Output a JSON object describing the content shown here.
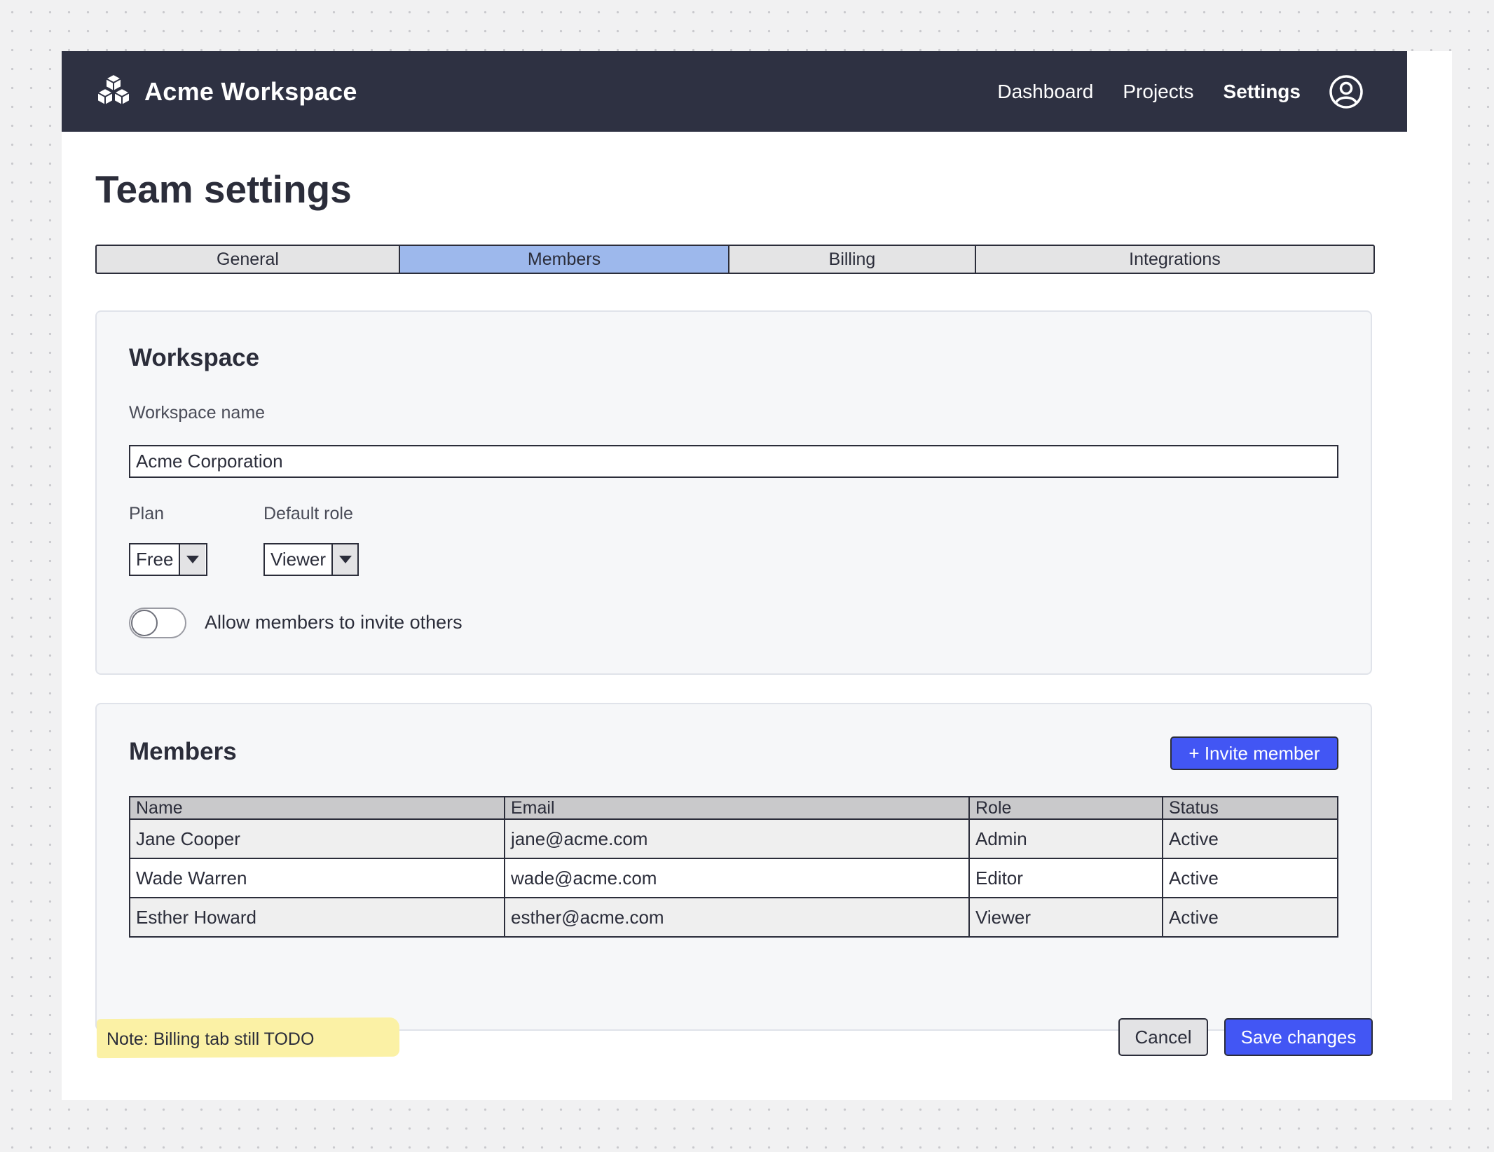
{
  "app": {
    "brand_name": "Acme Workspace",
    "brand_icon": "cubes-icon"
  },
  "nav": {
    "items": [
      {
        "label": "Dashboard",
        "active": false
      },
      {
        "label": "Projects",
        "active": false
      },
      {
        "label": "Settings",
        "active": true
      }
    ],
    "avatar_icon": "user-circle-icon"
  },
  "page": {
    "title": "Team settings"
  },
  "tabs": [
    {
      "label": "General",
      "active": false
    },
    {
      "label": "Members",
      "active": true
    },
    {
      "label": "Billing",
      "active": false
    },
    {
      "label": "Integrations",
      "active": false
    }
  ],
  "workspace": {
    "title": "Workspace",
    "name_label": "Workspace name",
    "name_value": "Acme Corporation",
    "plan_label": "Plan",
    "plan_value": "Free",
    "role_label": "Default role",
    "role_value": "Viewer",
    "invite_toggle_label": "Allow members to invite others",
    "invite_toggle_on": false
  },
  "members": {
    "title": "Members",
    "invite_button": "+ Invite member",
    "columns": [
      "Name",
      "Email",
      "Role",
      "Status"
    ],
    "rows": [
      {
        "name": "Jane Cooper",
        "email": "jane@acme.com",
        "role": "Admin",
        "status": "Active"
      },
      {
        "name": "Wade Warren",
        "email": "wade@acme.com",
        "role": "Editor",
        "status": "Active"
      },
      {
        "name": "Esther Howard",
        "email": "esther@acme.com",
        "role": "Viewer",
        "status": "Active"
      }
    ]
  },
  "footer": {
    "note": "Note: Billing tab still TODO",
    "cancel_label": "Cancel",
    "save_label": "Save changes"
  },
  "colors": {
    "topbar": "#2e3142",
    "accent": "#4256f4",
    "active_tab": "#9db8ec",
    "note_highlight": "#fbf1a5"
  }
}
